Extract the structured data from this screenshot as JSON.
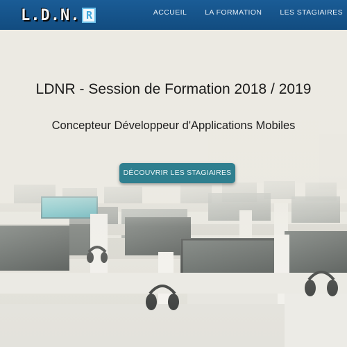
{
  "brand": {
    "logo_text": "L.D.N.",
    "logo_box_letter": "R"
  },
  "nav": {
    "items": [
      {
        "label": "ACCUEIL"
      },
      {
        "label": "LA FORMATION"
      },
      {
        "label": "LES STAGIAIRES"
      }
    ]
  },
  "hero": {
    "title": "LDNR - Session de Formation 2018 / 2019",
    "subtitle": "Concepteur Développeur d'Applications Mobiles",
    "cta_label": "DÉCOUVRIR LES STAGIAIRES"
  },
  "colors": {
    "navbar": "#174f84",
    "cta": "#2f7f8f",
    "logo_accent": "#6fc2ea"
  }
}
